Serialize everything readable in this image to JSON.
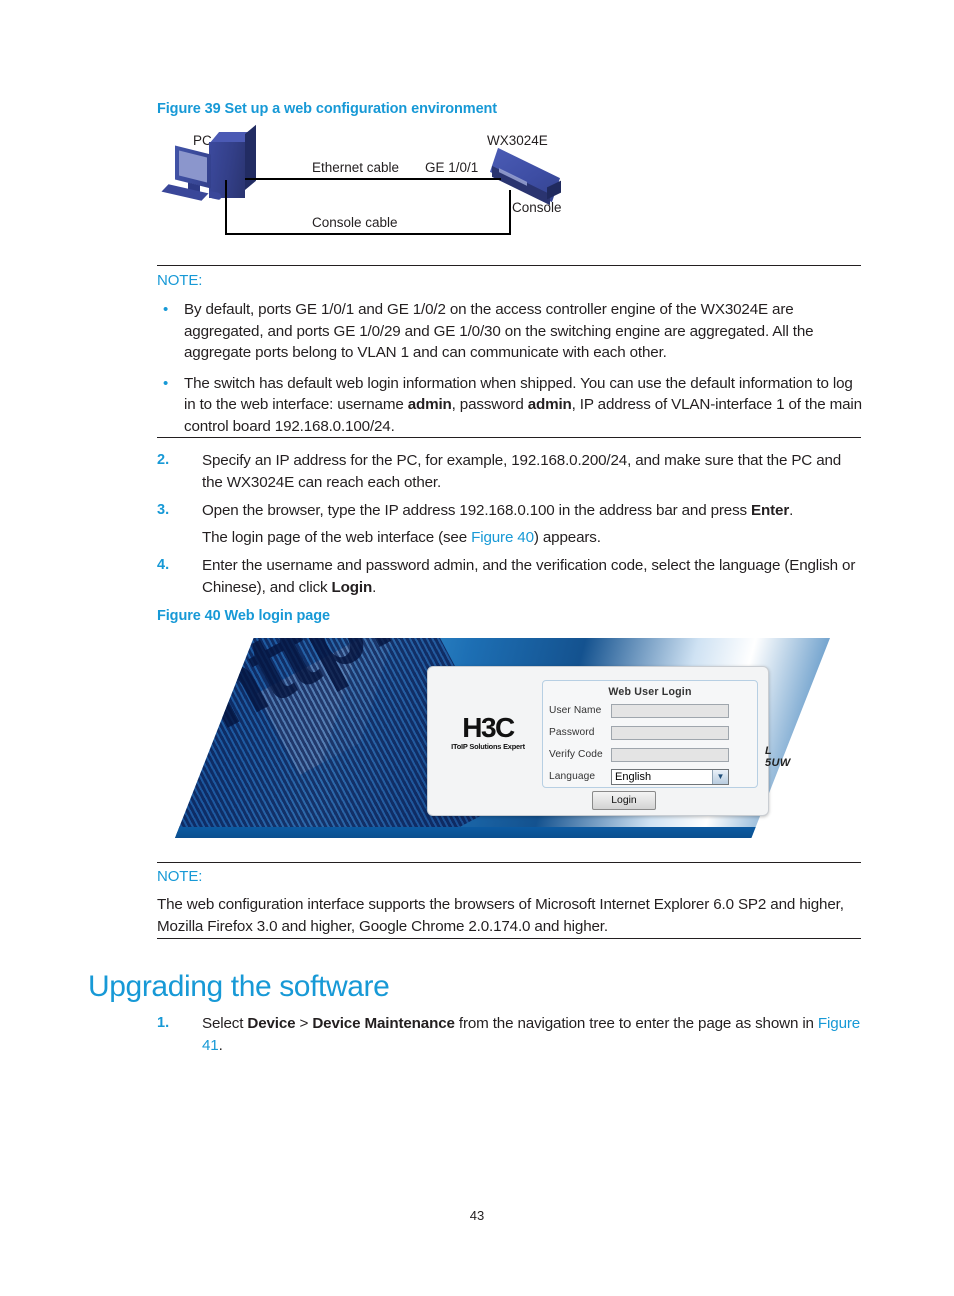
{
  "page": {
    "number": "43"
  },
  "figure39": {
    "title": "Figure 39 Set up a web configuration environment",
    "labels": {
      "pc": "PC",
      "device": "WX3024E",
      "ethernet_cable": "Ethernet cable",
      "port": "GE 1/0/1",
      "console": "Console",
      "console_cable": "Console cable"
    }
  },
  "note1": {
    "label": "NOTE:",
    "bullets": [
      {
        "part1": "By default, ports GE 1/0/1 and GE 1/0/2 on the access controller engine of the WX3024E are aggregated, and ports GE 1/0/29 and GE 1/0/30 on the switching engine are aggregated. All the aggregate ports belong to VLAN 1 and can communicate with each other."
      },
      {
        "part1": "The switch has default web login information when shipped. You can use the default information to log in to the web interface: username ",
        "bold1": "admin",
        "part2": ", password ",
        "bold2": "admin",
        "part3": ", IP address of VLAN-interface 1 of the main control board 192.168.0.100/24."
      }
    ]
  },
  "steps_web": [
    {
      "num": "2.",
      "part1": "Specify an IP address for the PC, for example, 192.168.0.200/24, and make sure that the PC and the WX3024E can reach each other."
    },
    {
      "num": "3.",
      "part1": "Open the browser, type the IP address 192.168.0.100 in the address bar and press ",
      "bold1": "Enter",
      "part2": ".",
      "sub_part1": "The login page of the web interface (see ",
      "sub_link": "Figure 40",
      "sub_part2": ") appears."
    },
    {
      "num": "4.",
      "part1": "Enter the username and password admin, and the verification code, select the language (English or Chinese), and click ",
      "bold1": "Login",
      "part2": "."
    }
  ],
  "figure40": {
    "title": "Figure 40 Web login page",
    "background_text": "http://www",
    "logo": {
      "mark": "H3C",
      "tagline": "IToIP Solutions Expert"
    },
    "login_form": {
      "title": "Web User Login",
      "fields": [
        {
          "label": "User Name",
          "value": ""
        },
        {
          "label": "Password",
          "value": ""
        },
        {
          "label": "Verify Code",
          "value": ""
        }
      ],
      "language_label": "Language",
      "language_value": "English",
      "captcha": "L 5UW",
      "submit_label": "Login"
    }
  },
  "note2": {
    "label": "NOTE:",
    "text": "The web configuration interface supports the browsers of Microsoft Internet Explorer 6.0 SP2 and higher, Mozilla Firefox 3.0 and higher, Google Chrome 2.0.174.0 and higher."
  },
  "section": {
    "title": "Upgrading the software",
    "steps": [
      {
        "num": "1.",
        "part1": "Select ",
        "bold1": "Device",
        "part2": " > ",
        "bold2": "Device Maintenance",
        "part3": " from the navigation tree to enter the page as shown in ",
        "link": "Figure 41",
        "part4": "."
      }
    ]
  },
  "colors": {
    "accent": "#1799d6",
    "text": "#231f20",
    "device_blue": "#3d4da3"
  }
}
